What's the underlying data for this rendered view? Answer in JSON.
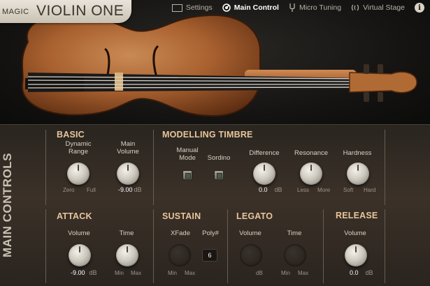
{
  "app": {
    "magic": "MAGIC",
    "name": "VIOLIN ONE"
  },
  "nav": {
    "settings": "Settings",
    "main_control": "Main Control",
    "micro_tuning": "Micro Tuning",
    "virtual_stage": "Virtual Stage",
    "info": "i"
  },
  "panel_label": "MAIN CONTROLS",
  "basic": {
    "title": "BASIC",
    "dynamic_range": "Dynamic\nRange",
    "dynamic_range_min": "Zero",
    "dynamic_range_max": "Full",
    "main_volume": "Main\nVolume",
    "main_volume_value": "-9.00",
    "main_volume_unit": "dB"
  },
  "timbre": {
    "title": "MODELLING TIMBRE",
    "manual_mode": "Manual\nMode",
    "sordino": "Sordino",
    "difference": "Difference",
    "difference_value": "0.0",
    "difference_unit": "dB",
    "resonance": "Resonance",
    "resonance_min": "Less",
    "resonance_max": "More",
    "hardness": "Hardness",
    "hardness_min": "Soft",
    "hardness_max": "Hard"
  },
  "attack": {
    "title": "ATTACK",
    "volume": "Volume",
    "volume_value": "-9.00",
    "volume_unit": "dB",
    "time": "Time",
    "time_min": "Min",
    "time_max": "Max"
  },
  "sustain": {
    "title": "SUSTAIN",
    "xfade": "XFade",
    "xfade_min": "Min",
    "xfade_max": "Max",
    "poly": "Poly#",
    "poly_value": "6"
  },
  "legato": {
    "title": "LEGATO",
    "volume": "Volume",
    "volume_unit": "dB",
    "time": "Time",
    "time_min": "Min",
    "time_max": "Max"
  },
  "release": {
    "title": "RELEASE",
    "volume": "Volume",
    "volume_value": "0.0",
    "volume_unit": "dB"
  },
  "colors": {
    "section_title": "#e8c59c",
    "panel_bg": "#3b3128",
    "logo_bg": "#e9e4da"
  }
}
